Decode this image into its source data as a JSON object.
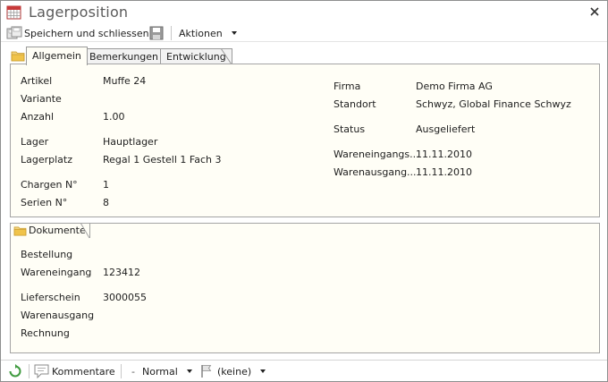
{
  "window": {
    "title": "Lagerposition"
  },
  "toolbar": {
    "save_close_label": "Speichern und schliessen",
    "actions_label": "Aktionen"
  },
  "tabs": [
    {
      "label": "Allgemein",
      "active": true
    },
    {
      "label": "Bemerkungen",
      "active": false
    },
    {
      "label": "Entwicklung",
      "active": false
    }
  ],
  "general": {
    "left": [
      {
        "label": "Artikel",
        "value": "Muffe 24"
      },
      {
        "label": "Variante",
        "value": ""
      },
      {
        "label": "Anzahl",
        "value": "1.00"
      },
      {
        "label": "Lager",
        "value": "Hauptlager"
      },
      {
        "label": "Lagerplatz",
        "value": "Regal 1 Gestell 1 Fach 3"
      },
      {
        "label": "Chargen N°",
        "value": "1"
      },
      {
        "label": "Serien N°",
        "value": "8"
      }
    ],
    "right": [
      {
        "label": "Firma",
        "value": "Demo Firma AG"
      },
      {
        "label": "Standort",
        "value": "Schwyz, Global Finance Schwyz"
      },
      {
        "label": "Status",
        "value": "Ausgeliefert"
      },
      {
        "label": "Wareneingangs...",
        "value": "11.11.2010"
      },
      {
        "label": "Warenausgang...",
        "value": "11.11.2010"
      }
    ]
  },
  "documents": {
    "title": "Dokumente",
    "fields": [
      {
        "label": "Bestellung",
        "value": ""
      },
      {
        "label": "Wareneingang",
        "value": "123412"
      },
      {
        "label": "Lieferschein",
        "value": "3000055"
      },
      {
        "label": "Warenausgang",
        "value": ""
      },
      {
        "label": "Rechnung",
        "value": ""
      }
    ]
  },
  "statusbar": {
    "comments_label": "Kommentare",
    "priority_label": "Normal",
    "flag_label": "(keine)"
  },
  "colors": {
    "panel_bg": "#fffef6",
    "border": "#a4a4a4",
    "folder": "#f0c34a",
    "refresh_green": "#3f9a3f"
  }
}
